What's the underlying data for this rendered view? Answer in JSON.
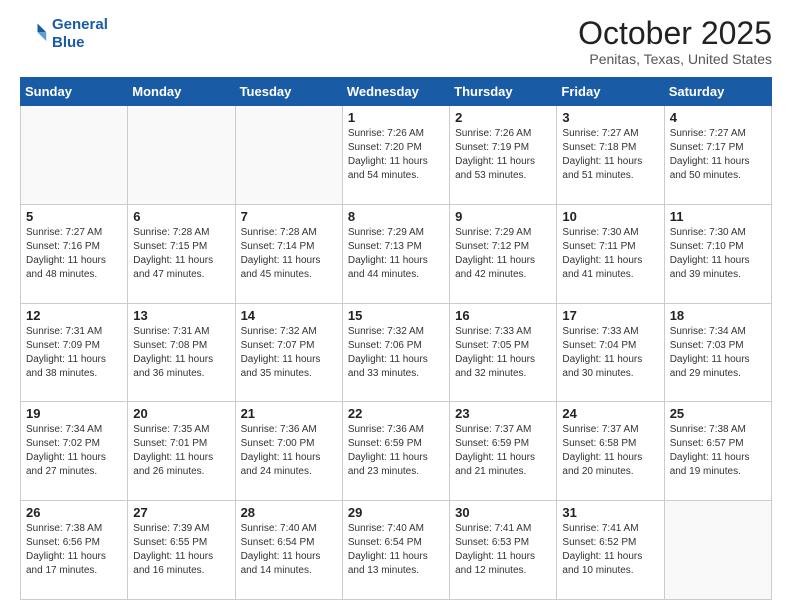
{
  "logo": {
    "line1": "General",
    "line2": "Blue"
  },
  "header": {
    "title": "October 2025",
    "subtitle": "Penitas, Texas, United States"
  },
  "weekdays": [
    "Sunday",
    "Monday",
    "Tuesday",
    "Wednesday",
    "Thursday",
    "Friday",
    "Saturday"
  ],
  "weeks": [
    [
      {
        "day": "",
        "info": ""
      },
      {
        "day": "",
        "info": ""
      },
      {
        "day": "",
        "info": ""
      },
      {
        "day": "1",
        "info": "Sunrise: 7:26 AM\nSunset: 7:20 PM\nDaylight: 11 hours\nand 54 minutes."
      },
      {
        "day": "2",
        "info": "Sunrise: 7:26 AM\nSunset: 7:19 PM\nDaylight: 11 hours\nand 53 minutes."
      },
      {
        "day": "3",
        "info": "Sunrise: 7:27 AM\nSunset: 7:18 PM\nDaylight: 11 hours\nand 51 minutes."
      },
      {
        "day": "4",
        "info": "Sunrise: 7:27 AM\nSunset: 7:17 PM\nDaylight: 11 hours\nand 50 minutes."
      }
    ],
    [
      {
        "day": "5",
        "info": "Sunrise: 7:27 AM\nSunset: 7:16 PM\nDaylight: 11 hours\nand 48 minutes."
      },
      {
        "day": "6",
        "info": "Sunrise: 7:28 AM\nSunset: 7:15 PM\nDaylight: 11 hours\nand 47 minutes."
      },
      {
        "day": "7",
        "info": "Sunrise: 7:28 AM\nSunset: 7:14 PM\nDaylight: 11 hours\nand 45 minutes."
      },
      {
        "day": "8",
        "info": "Sunrise: 7:29 AM\nSunset: 7:13 PM\nDaylight: 11 hours\nand 44 minutes."
      },
      {
        "day": "9",
        "info": "Sunrise: 7:29 AM\nSunset: 7:12 PM\nDaylight: 11 hours\nand 42 minutes."
      },
      {
        "day": "10",
        "info": "Sunrise: 7:30 AM\nSunset: 7:11 PM\nDaylight: 11 hours\nand 41 minutes."
      },
      {
        "day": "11",
        "info": "Sunrise: 7:30 AM\nSunset: 7:10 PM\nDaylight: 11 hours\nand 39 minutes."
      }
    ],
    [
      {
        "day": "12",
        "info": "Sunrise: 7:31 AM\nSunset: 7:09 PM\nDaylight: 11 hours\nand 38 minutes."
      },
      {
        "day": "13",
        "info": "Sunrise: 7:31 AM\nSunset: 7:08 PM\nDaylight: 11 hours\nand 36 minutes."
      },
      {
        "day": "14",
        "info": "Sunrise: 7:32 AM\nSunset: 7:07 PM\nDaylight: 11 hours\nand 35 minutes."
      },
      {
        "day": "15",
        "info": "Sunrise: 7:32 AM\nSunset: 7:06 PM\nDaylight: 11 hours\nand 33 minutes."
      },
      {
        "day": "16",
        "info": "Sunrise: 7:33 AM\nSunset: 7:05 PM\nDaylight: 11 hours\nand 32 minutes."
      },
      {
        "day": "17",
        "info": "Sunrise: 7:33 AM\nSunset: 7:04 PM\nDaylight: 11 hours\nand 30 minutes."
      },
      {
        "day": "18",
        "info": "Sunrise: 7:34 AM\nSunset: 7:03 PM\nDaylight: 11 hours\nand 29 minutes."
      }
    ],
    [
      {
        "day": "19",
        "info": "Sunrise: 7:34 AM\nSunset: 7:02 PM\nDaylight: 11 hours\nand 27 minutes."
      },
      {
        "day": "20",
        "info": "Sunrise: 7:35 AM\nSunset: 7:01 PM\nDaylight: 11 hours\nand 26 minutes."
      },
      {
        "day": "21",
        "info": "Sunrise: 7:36 AM\nSunset: 7:00 PM\nDaylight: 11 hours\nand 24 minutes."
      },
      {
        "day": "22",
        "info": "Sunrise: 7:36 AM\nSunset: 6:59 PM\nDaylight: 11 hours\nand 23 minutes."
      },
      {
        "day": "23",
        "info": "Sunrise: 7:37 AM\nSunset: 6:59 PM\nDaylight: 11 hours\nand 21 minutes."
      },
      {
        "day": "24",
        "info": "Sunrise: 7:37 AM\nSunset: 6:58 PM\nDaylight: 11 hours\nand 20 minutes."
      },
      {
        "day": "25",
        "info": "Sunrise: 7:38 AM\nSunset: 6:57 PM\nDaylight: 11 hours\nand 19 minutes."
      }
    ],
    [
      {
        "day": "26",
        "info": "Sunrise: 7:38 AM\nSunset: 6:56 PM\nDaylight: 11 hours\nand 17 minutes."
      },
      {
        "day": "27",
        "info": "Sunrise: 7:39 AM\nSunset: 6:55 PM\nDaylight: 11 hours\nand 16 minutes."
      },
      {
        "day": "28",
        "info": "Sunrise: 7:40 AM\nSunset: 6:54 PM\nDaylight: 11 hours\nand 14 minutes."
      },
      {
        "day": "29",
        "info": "Sunrise: 7:40 AM\nSunset: 6:54 PM\nDaylight: 11 hours\nand 13 minutes."
      },
      {
        "day": "30",
        "info": "Sunrise: 7:41 AM\nSunset: 6:53 PM\nDaylight: 11 hours\nand 12 minutes."
      },
      {
        "day": "31",
        "info": "Sunrise: 7:41 AM\nSunset: 6:52 PM\nDaylight: 11 hours\nand 10 minutes."
      },
      {
        "day": "",
        "info": ""
      }
    ]
  ]
}
